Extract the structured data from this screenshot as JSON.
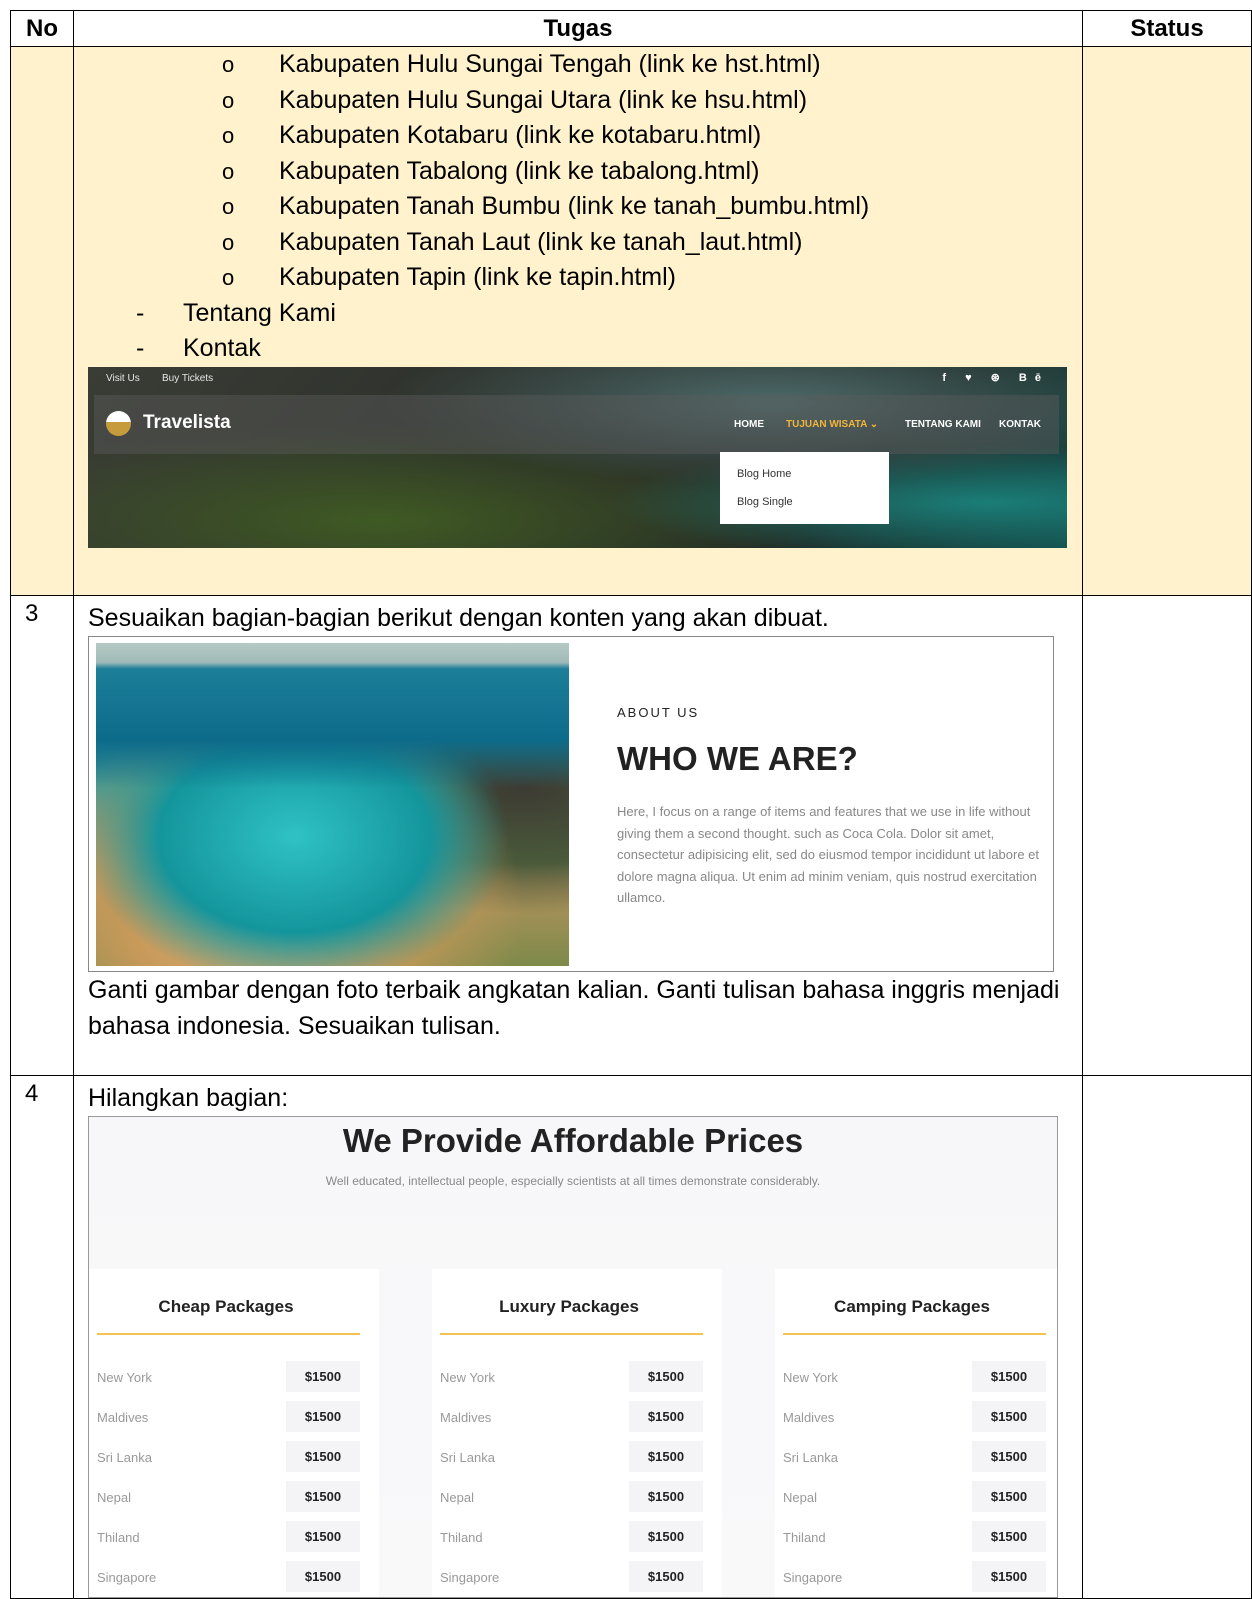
{
  "table": {
    "headers": {
      "no": "No",
      "tugas": "Tugas",
      "status": "Status"
    }
  },
  "row_menu": {
    "sub_items": [
      "Kabupaten Hulu Sungai Tengah (link ke hst.html)",
      "Kabupaten Hulu Sungai Utara (link ke hsu.html)",
      "Kabupaten Kotabaru (link ke kotabaru.html)",
      "Kabupaten Tabalong (link ke tabalong.html)",
      "Kabupaten Tanah Bumbu (link ke tanah_bumbu.html)",
      "Kabupaten Tanah Laut (link ke tanah_laut.html)",
      "Kabupaten Tapin (link ke tapin.html)"
    ],
    "sub_bullet": "o",
    "main_items": [
      "Tentang Kami",
      "Kontak"
    ],
    "main_bullet": "-",
    "screenshot": {
      "topbar_links": [
        "Visit Us",
        "Buy Tickets"
      ],
      "social": "f  ♥  ⊛  Bē",
      "logo": "Travelista",
      "nav": [
        "HOME",
        "TUJUAN WISATA ⌄",
        "TENTANG KAMI",
        "KONTAK"
      ],
      "dropdown": [
        "Blog Home",
        "Blog Single"
      ]
    }
  },
  "row3": {
    "no": "3",
    "intro": "Sesuaikan bagian-bagian berikut dengan konten yang akan dibuat.",
    "screenshot": {
      "label": "ABOUT US",
      "title": "WHO WE ARE?",
      "paragraph": "Here, I focus on a range of items and features that we use in life without giving them a second thought. such as Coca Cola. Dolor sit amet, consectetur adipisicing elit, sed do eiusmod tempor incididunt ut labore et dolore magna aliqua. Ut enim ad minim veniam, quis nostrud exercitation ullamco."
    },
    "note": "Ganti gambar dengan foto terbaik angkatan kalian. Ganti tulisan bahasa inggris menjadi bahasa indonesia. Sesuaikan tulisan."
  },
  "row4": {
    "no": "4",
    "intro": "Hilangkan bagian:",
    "screenshot": {
      "title": "We Provide Affordable Prices",
      "subtitle": "Well educated, intellectual people, especially scientists at all times demonstrate considerably.",
      "packages": [
        {
          "name": "Cheap Packages",
          "rows": [
            [
              "New York",
              "$1500"
            ],
            [
              "Maldives",
              "$1500"
            ],
            [
              "Sri Lanka",
              "$1500"
            ],
            [
              "Nepal",
              "$1500"
            ],
            [
              "Thiland",
              "$1500"
            ],
            [
              "Singapore",
              "$1500"
            ]
          ]
        },
        {
          "name": "Luxury Packages",
          "rows": [
            [
              "New York",
              "$1500"
            ],
            [
              "Maldives",
              "$1500"
            ],
            [
              "Sri Lanka",
              "$1500"
            ],
            [
              "Nepal",
              "$1500"
            ],
            [
              "Thiland",
              "$1500"
            ],
            [
              "Singapore",
              "$1500"
            ]
          ]
        },
        {
          "name": "Camping Packages",
          "rows": [
            [
              "New York",
              "$1500"
            ],
            [
              "Maldives",
              "$1500"
            ],
            [
              "Sri Lanka",
              "$1500"
            ],
            [
              "Nepal",
              "$1500"
            ],
            [
              "Thiland",
              "$1500"
            ],
            [
              "Singapore",
              "$1500"
            ]
          ]
        }
      ]
    }
  }
}
